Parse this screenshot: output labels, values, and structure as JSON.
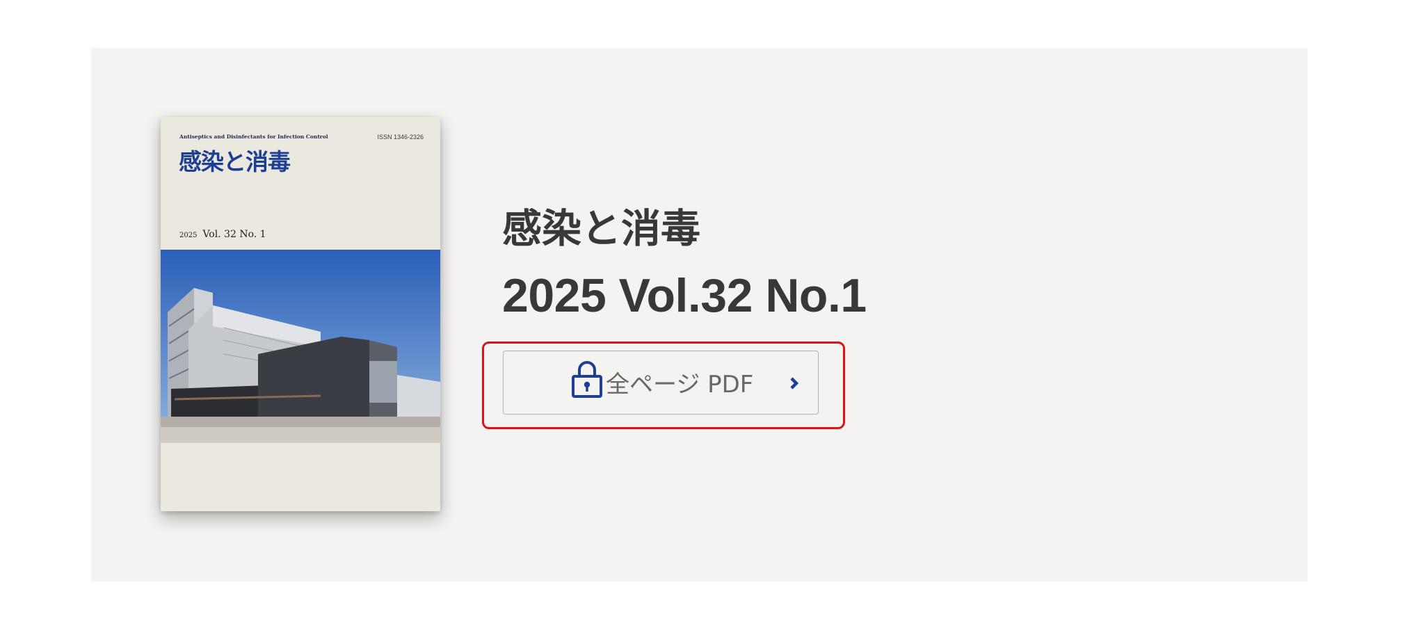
{
  "cover": {
    "subtitle": "Antiseptics and Disinfectants for Infection Control",
    "issn": "ISSN 1346-2326",
    "title": "感染と消毒",
    "year": "2025",
    "volume_issue": "Vol. 32  No. 1"
  },
  "journal": {
    "title": "感染と消毒",
    "issue": "2025 Vol.32 No.1"
  },
  "download_button": {
    "label": "全ページ PDF",
    "icon": "lock-icon",
    "arrow_icon": "chevron-right-icon"
  },
  "colors": {
    "accent_blue": "#1c3f93",
    "highlight_red": "#e01019",
    "panel_bg": "#f4f3f1"
  }
}
